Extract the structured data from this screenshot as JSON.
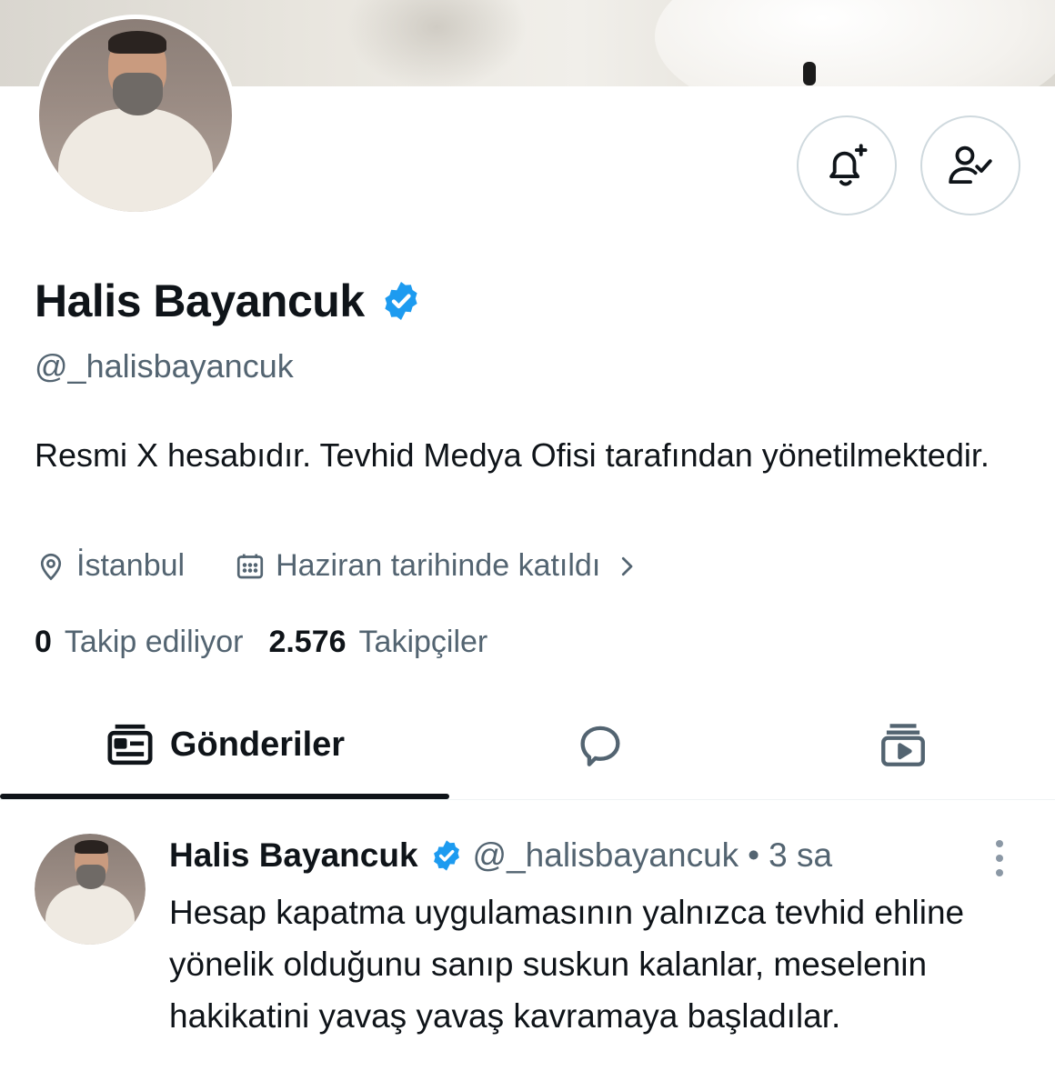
{
  "profile": {
    "name": "Halis Bayancuk",
    "handle": "@_halisbayancuk",
    "bio": "Resmi X hesabıdır. Tevhid Medya Ofisi tarafından yönetilmektedir.",
    "location": "İstanbul",
    "joined": "Haziran tarihinde katıldı",
    "following_count": "0",
    "following_label": "Takip ediliyor",
    "followers_count": "2.576",
    "followers_label": "Takipçiler",
    "verified": true
  },
  "actions": {
    "notify_icon": "bell-plus-icon",
    "following_icon": "person-check-icon"
  },
  "tabs": [
    {
      "label": "Gönderiler",
      "icon": "posts-icon",
      "active": true
    },
    {
      "label": "",
      "icon": "speech-bubble-icon",
      "active": false
    },
    {
      "label": "",
      "icon": "media-play-icon",
      "active": false
    }
  ],
  "post": {
    "author": "Halis Bayancuk",
    "handle": "@_halisbayancuk",
    "separator": "•",
    "time": "3 sa",
    "text": "Hesap kapatma uygulamasının yalnızca tevhid ehline yönelik olduğunu sanıp suskun kalanlar, meselenin hakikatini yavaş yavaş kavramaya başladılar."
  },
  "colors": {
    "text_primary": "#0f1419",
    "text_secondary": "#536471",
    "verified_blue": "#1d9bf0",
    "border": "#cfd9de"
  }
}
